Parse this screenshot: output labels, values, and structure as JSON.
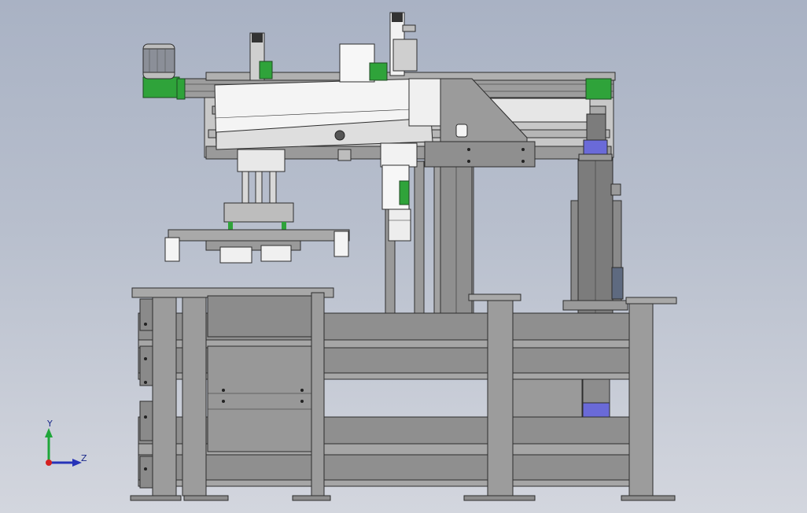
{
  "viewport": {
    "background_top": "#a9b2c4",
    "background_bottom": "#d3d6de"
  },
  "colors": {
    "steel": "#8f8f8f",
    "steel_light": "#a7a7a7",
    "steel_dark": "#6e6e6e",
    "edge": "#2d2d2d",
    "white_part": "#f4f4f4",
    "green_part": "#2fa33a",
    "motor_blue": "#6a6ad8",
    "motor_dark": "#555b73",
    "axis_x": "#d42020",
    "axis_y": "#1fa63a",
    "axis_z": "#2733b8"
  },
  "icons": {
    "triad": "coordinate-triad-icon"
  },
  "triad": {
    "y_label": "Y",
    "z_label": "Z"
  }
}
